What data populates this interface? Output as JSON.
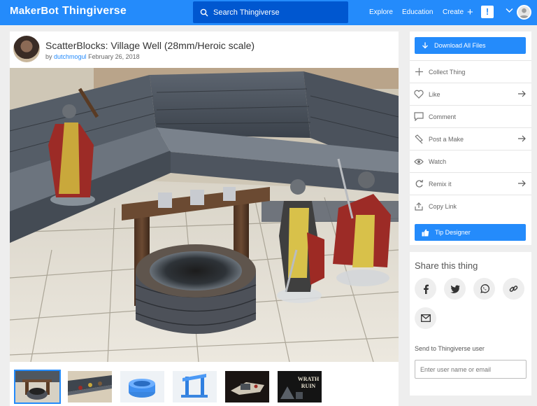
{
  "header": {
    "logo_part1": "MakerBot",
    "logo_part2": "Thingiverse",
    "search_placeholder": "Search Thingiverse",
    "nav": {
      "explore": "Explore",
      "education": "Education",
      "create": "Create"
    },
    "notification_glyph": "!",
    "colors": {
      "bar": "#248bfb",
      "search": "#0057d0"
    }
  },
  "thing": {
    "title": "ScatterBlocks: Village Well (28mm/Heroic scale)",
    "by": "by",
    "author": "dutchmogul",
    "date": "February 26, 2018"
  },
  "gallery": {
    "thumbnails": [
      "thumb-1",
      "thumb-2",
      "thumb-3",
      "thumb-4",
      "thumb-5",
      "thumb-6"
    ],
    "logo_text_line1": "WRATH",
    "logo_text_line2": "RUIN"
  },
  "sidebar": {
    "download": "Download All Files",
    "actions": {
      "collect": "Collect Thing",
      "like": "Like",
      "comment": "Comment",
      "post_make": "Post a Make",
      "watch": "Watch",
      "remix": "Remix it",
      "copy_link": "Copy Link"
    },
    "tip": "Tip Designer"
  },
  "share": {
    "title": "Share this thing",
    "icons": [
      "facebook-icon",
      "twitter-icon",
      "whatsapp-icon",
      "link-icon",
      "email-icon"
    ],
    "send_label": "Send to Thingiverse user",
    "input_placeholder": "Enter user name or email"
  }
}
